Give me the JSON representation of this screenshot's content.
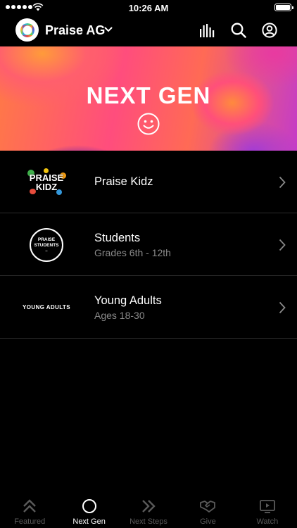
{
  "status_bar": {
    "time": "10:26 AM"
  },
  "header": {
    "org_name": "Praise AG"
  },
  "banner": {
    "title": "NEXT GEN"
  },
  "items": [
    {
      "logo_lines": [
        "PRAISE",
        "KIDZ"
      ],
      "title": "Praise Kidz",
      "subtitle": ""
    },
    {
      "logo_lines": [
        "PRAISE",
        "STUDENTS"
      ],
      "title": "Students",
      "subtitle": "Grades 6th - 12th"
    },
    {
      "logo_text": "YOUNG ADULTS",
      "title": "Young Adults",
      "subtitle": "Ages 18-30"
    }
  ],
  "tabs": [
    {
      "label": "Featured",
      "icon": "chevrons-up-icon",
      "active": false
    },
    {
      "label": "Next Gen",
      "icon": "circle-icon",
      "active": true
    },
    {
      "label": "Next Steps",
      "icon": "chevrons-right-icon",
      "active": false
    },
    {
      "label": "Give",
      "icon": "handshake-icon",
      "active": false
    },
    {
      "label": "Watch",
      "icon": "play-screen-icon",
      "active": false
    }
  ],
  "colors": {
    "background": "#000000",
    "active_tab": "#ffffff",
    "inactive_tab": "#5a5a5a",
    "subtitle": "#8a8a8a"
  }
}
